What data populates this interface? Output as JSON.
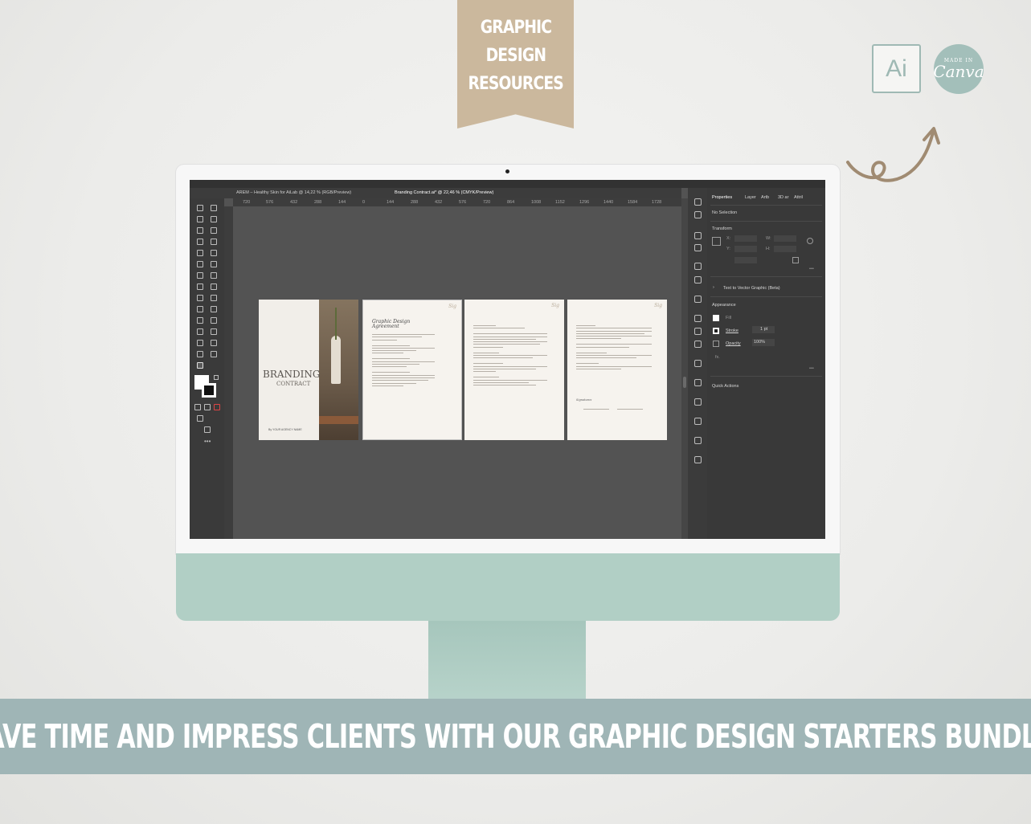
{
  "ribbon": {
    "lines": [
      "GRAPHIC",
      "DESIGN",
      "RESOURCES"
    ],
    "color": "#cbb89d"
  },
  "logos": {
    "ai_label": "Ai",
    "canva_small": "MADE IN",
    "canva_label": "Canva"
  },
  "banner": {
    "text": "SAVE TIME AND IMPRESS CLIENTS WITH OUR GRAPHIC DESIGN STARTERS BUNDLE!",
    "color": "#9fb5b6"
  },
  "monitor": {
    "chin_color": "#b1cfc5"
  },
  "app": {
    "tabs": [
      "AREM – Healthy Skin for AiLab @ 14,22 % (RGB/Preview)",
      "Branding Contract.ai* @ 22,46 % (CMYK/Preview)"
    ],
    "ruler_ticks": [
      "720",
      "576",
      "432",
      "288",
      "144",
      "0",
      "144",
      "288",
      "432",
      "576",
      "720",
      "864",
      "1008",
      "1152",
      "1296",
      "1440",
      "1584",
      "1728"
    ],
    "panel_tabs": [
      "Properties",
      "Layer",
      "Artb",
      "3D ar",
      "Attril"
    ],
    "properties": {
      "selection": "No Selection",
      "transform": "Transform",
      "x_label": "X:",
      "y_label": "Y:",
      "w_label": "W:",
      "h_label": "H:",
      "text_to_vector": "Text to Vector Graphic (Beta)",
      "appearance": "Appearance",
      "fill": "Fill",
      "stroke": "Stroke",
      "stroke_value": "1 pt",
      "opacity": "Opacity",
      "opacity_value": "100%",
      "fx": "fx.",
      "quick_actions": "Quick Actions"
    }
  },
  "artboards": {
    "cover_title": "BRANDING",
    "cover_subtitle": "CONTRACT",
    "cover_author": "By YOUR AGENCY NAME",
    "page2_title": "Graphic Design",
    "page2_subtitle": "Agreement",
    "signature": "Sig",
    "page4_signatures": "Signatures"
  }
}
